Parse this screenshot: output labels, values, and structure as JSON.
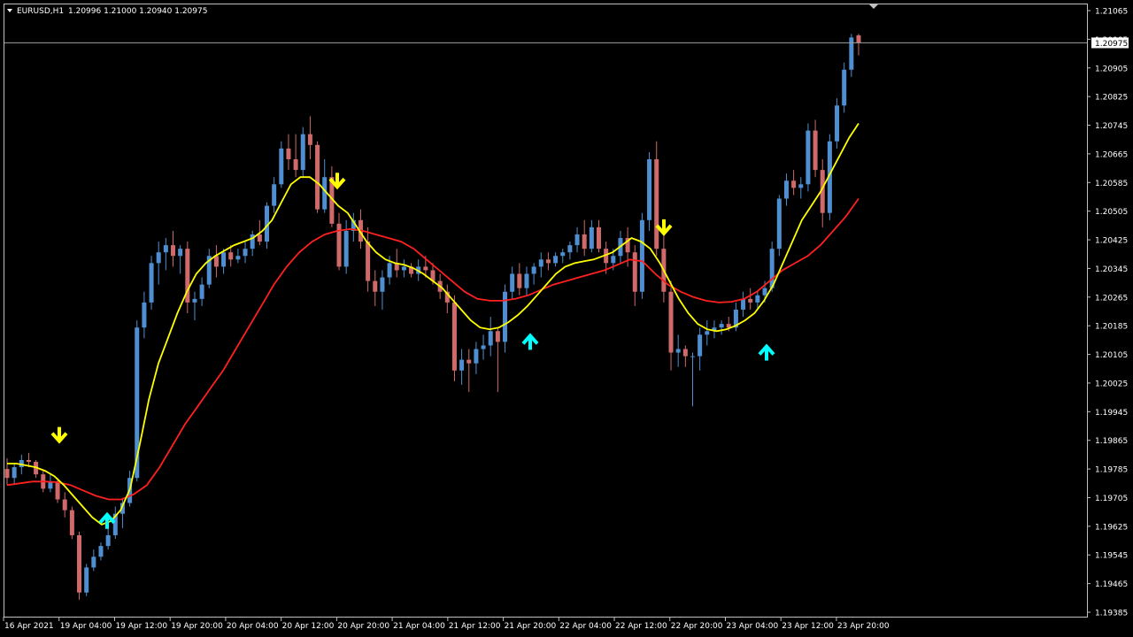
{
  "info": {
    "symbol": "EURUSD,H1",
    "ohlc": "1.20996 1.21000 1.20940 1.20975"
  },
  "colors": {
    "background": "#000000",
    "frame": "#c0c0c0",
    "bull": "#4f8fd1",
    "bear": "#d06a6a",
    "ma_fast": "#ffff00",
    "ma_slow": "#ff2020",
    "arrow_up": "#00ffff",
    "arrow_down": "#ffff00",
    "text": "#ffffff"
  },
  "chart_data": {
    "type": "candlestick",
    "title": "EURUSD,H1",
    "ylim": [
      1.19385,
      1.21065
    ],
    "y_ticks": [
      "1.21065",
      "1.20985",
      "1.20905",
      "1.20825",
      "1.20745",
      "1.20665",
      "1.20585",
      "1.20505",
      "1.20425",
      "1.20345",
      "1.20265",
      "1.20185",
      "1.20105",
      "1.20025",
      "1.19945",
      "1.19865",
      "1.19785",
      "1.19705",
      "1.19625",
      "1.19545",
      "1.19465",
      "1.19385"
    ],
    "x_ticks": [
      "16 Apr 2021",
      "19 Apr 04:00",
      "19 Apr 12:00",
      "19 Apr 20:00",
      "20 Apr 04:00",
      "20 Apr 12:00",
      "20 Apr 20:00",
      "21 Apr 04:00",
      "21 Apr 12:00",
      "21 Apr 20:00",
      "22 Apr 04:00",
      "22 Apr 12:00",
      "22 Apr 20:00",
      "23 Apr 04:00",
      "23 Apr 12:00",
      "23 Apr 20:00"
    ],
    "current_price": "1.20975",
    "candles": [
      [
        1.19785,
        1.19815,
        1.1974,
        1.1976
      ],
      [
        1.1976,
        1.198,
        1.1974,
        1.1979
      ],
      [
        1.1979,
        1.19825,
        1.1977,
        1.1981
      ],
      [
        1.1981,
        1.1983,
        1.1979,
        1.19805
      ],
      [
        1.19805,
        1.1981,
        1.1976,
        1.1977
      ],
      [
        1.1977,
        1.1978,
        1.1972,
        1.1973
      ],
      [
        1.1973,
        1.1977,
        1.1972,
        1.1975
      ],
      [
        1.1975,
        1.1976,
        1.1969,
        1.197
      ],
      [
        1.197,
        1.1972,
        1.1965,
        1.1967
      ],
      [
        1.1967,
        1.1968,
        1.1959,
        1.196
      ],
      [
        1.196,
        1.1961,
        1.1942,
        1.1944
      ],
      [
        1.1944,
        1.1952,
        1.1943,
        1.1951
      ],
      [
        1.1951,
        1.1956,
        1.195,
        1.1954
      ],
      [
        1.1954,
        1.1958,
        1.1953,
        1.1957
      ],
      [
        1.1957,
        1.1962,
        1.1956,
        1.196
      ],
      [
        1.196,
        1.1968,
        1.1959,
        1.1966
      ],
      [
        1.1966,
        1.197,
        1.1962,
        1.1969
      ],
      [
        1.1969,
        1.1978,
        1.1968,
        1.1976
      ],
      [
        1.1976,
        1.202,
        1.1975,
        1.2018
      ],
      [
        1.2018,
        1.2028,
        1.2015,
        1.2025
      ],
      [
        1.2025,
        1.2038,
        1.2023,
        1.2036
      ],
      [
        1.2036,
        1.2042,
        1.203,
        1.2039
      ],
      [
        1.2039,
        1.2043,
        1.2034,
        1.2041
      ],
      [
        1.2041,
        1.2045,
        1.2035,
        1.2038
      ],
      [
        1.2038,
        1.2041,
        1.2033,
        1.204
      ],
      [
        1.204,
        1.2042,
        1.2022,
        1.2025
      ],
      [
        1.2025,
        1.2028,
        1.202,
        1.2026
      ],
      [
        1.2026,
        1.2032,
        1.2024,
        1.203
      ],
      [
        1.203,
        1.204,
        1.2029,
        1.2038
      ],
      [
        1.2038,
        1.2041,
        1.2032,
        1.2035
      ],
      [
        1.2035,
        1.204,
        1.2033,
        1.2039
      ],
      [
        1.2039,
        1.2041,
        1.2035,
        1.2037
      ],
      [
        1.2037,
        1.204,
        1.2036,
        1.2038
      ],
      [
        1.2038,
        1.2042,
        1.2036,
        1.204
      ],
      [
        1.204,
        1.2045,
        1.2038,
        1.2044
      ],
      [
        1.2044,
        1.2048,
        1.2041,
        1.2042
      ],
      [
        1.2042,
        1.2053,
        1.204,
        1.2052
      ],
      [
        1.2052,
        1.206,
        1.205,
        1.2058
      ],
      [
        1.2058,
        1.207,
        1.2057,
        1.2068
      ],
      [
        1.2068,
        1.2072,
        1.2062,
        1.2065
      ],
      [
        1.2065,
        1.2072,
        1.206,
        1.2062
      ],
      [
        1.2062,
        1.2074,
        1.206,
        1.2072
      ],
      [
        1.2072,
        1.2077,
        1.2065,
        1.2069
      ],
      [
        1.2069,
        1.207,
        1.205,
        1.2051
      ],
      [
        1.2051,
        1.2065,
        1.205,
        1.206
      ],
      [
        1.206,
        1.2063,
        1.2046,
        1.2047
      ],
      [
        1.2047,
        1.205,
        1.2034,
        1.2035
      ],
      [
        1.2035,
        1.2048,
        1.2033,
        1.2045
      ],
      [
        1.2045,
        1.205,
        1.2042,
        1.2048
      ],
      [
        1.2048,
        1.2051,
        1.204,
        1.2042
      ],
      [
        1.2042,
        1.2046,
        1.2028,
        1.2031
      ],
      [
        1.2031,
        1.2034,
        1.2024,
        1.2028
      ],
      [
        1.2028,
        1.2034,
        1.2023,
        1.2032
      ],
      [
        1.2032,
        1.2038,
        1.203,
        1.2036
      ],
      [
        1.2036,
        1.204,
        1.2032,
        1.2034
      ],
      [
        1.2034,
        1.2037,
        1.2032,
        1.2035
      ],
      [
        1.2035,
        1.2036,
        1.2032,
        1.2033
      ],
      [
        1.2033,
        1.2037,
        1.2031,
        1.2035
      ],
      [
        1.2035,
        1.2038,
        1.2032,
        1.2034
      ],
      [
        1.2034,
        1.2036,
        1.203,
        1.2031
      ],
      [
        1.2031,
        1.2033,
        1.2026,
        1.2028
      ],
      [
        1.2028,
        1.203,
        1.2022,
        1.2025
      ],
      [
        1.2025,
        1.2027,
        1.2003,
        1.2006
      ],
      [
        1.2006,
        1.2012,
        1.2002,
        1.2009
      ],
      [
        1.2009,
        1.2012,
        1.2,
        1.2008
      ],
      [
        1.2008,
        1.2014,
        1.2005,
        1.2012
      ],
      [
        1.2012,
        1.2016,
        1.2009,
        1.2013
      ],
      [
        1.2013,
        1.2021,
        1.201,
        1.2017
      ],
      [
        1.2017,
        1.2018,
        1.2,
        1.2014
      ],
      [
        1.2014,
        1.203,
        1.2011,
        1.2028
      ],
      [
        1.2028,
        1.2035,
        1.2026,
        1.2033
      ],
      [
        1.2033,
        1.2036,
        1.2027,
        1.2029
      ],
      [
        1.2029,
        1.2035,
        1.2027,
        1.2033
      ],
      [
        1.2033,
        1.2036,
        1.203,
        1.2035
      ],
      [
        1.2035,
        1.2039,
        1.2032,
        1.2037
      ],
      [
        1.2037,
        1.2039,
        1.2034,
        1.2036
      ],
      [
        1.2036,
        1.2039,
        1.2035,
        1.2038
      ],
      [
        1.2038,
        1.204,
        1.2036,
        1.2039
      ],
      [
        1.2039,
        1.2042,
        1.2037,
        1.2041
      ],
      [
        1.2041,
        1.2046,
        1.2039,
        1.2044
      ],
      [
        1.2044,
        1.2048,
        1.2038,
        1.204
      ],
      [
        1.204,
        1.2048,
        1.2039,
        1.2046
      ],
      [
        1.2046,
        1.2048,
        1.2039,
        1.204
      ],
      [
        1.204,
        1.2042,
        1.2033,
        1.2036
      ],
      [
        1.2036,
        1.204,
        1.2034,
        1.2038
      ],
      [
        1.2038,
        1.2045,
        1.2036,
        1.2043
      ],
      [
        1.2043,
        1.2046,
        1.2035,
        1.2039
      ],
      [
        1.2039,
        1.2041,
        1.2024,
        1.2028
      ],
      [
        1.2028,
        1.205,
        1.2026,
        1.2048
      ],
      [
        1.2048,
        1.2067,
        1.2045,
        1.2065
      ],
      [
        1.2065,
        1.207,
        1.2038,
        1.204
      ],
      [
        1.204,
        1.2045,
        1.2025,
        1.2028
      ],
      [
        1.2028,
        1.2031,
        1.2006,
        1.2011
      ],
      [
        1.2011,
        1.2016,
        1.2007,
        1.2012
      ],
      [
        1.2012,
        1.2013,
        1.2007,
        1.201
      ],
      [
        1.201,
        1.2011,
        1.1996,
        1.201
      ],
      [
        1.201,
        1.2018,
        1.2006,
        1.2016
      ],
      [
        1.2016,
        1.202,
        1.2013,
        1.2017
      ],
      [
        1.2017,
        1.202,
        1.2015,
        1.2018
      ],
      [
        1.2018,
        1.202,
        1.2016,
        1.2019
      ],
      [
        1.2019,
        1.2021,
        1.2017,
        1.2018
      ],
      [
        1.2018,
        1.2025,
        1.2017,
        1.2023
      ],
      [
        1.2023,
        1.2028,
        1.2021,
        1.2026
      ],
      [
        1.2026,
        1.2029,
        1.2023,
        1.2025
      ],
      [
        1.2025,
        1.2028,
        1.2023,
        1.2027
      ],
      [
        1.2027,
        1.2031,
        1.2025,
        1.2029
      ],
      [
        1.2029,
        1.2042,
        1.2028,
        1.204
      ],
      [
        1.204,
        1.2055,
        1.2038,
        1.2054
      ],
      [
        1.2054,
        1.2061,
        1.2052,
        1.2059
      ],
      [
        1.2059,
        1.2062,
        1.2055,
        1.2057
      ],
      [
        1.2057,
        1.206,
        1.2054,
        1.2058
      ],
      [
        1.2058,
        1.2075,
        1.2056,
        1.2073
      ],
      [
        1.2073,
        1.2076,
        1.206,
        1.2062
      ],
      [
        1.2062,
        1.2065,
        1.2046,
        1.205
      ],
      [
        1.205,
        1.2072,
        1.2048,
        1.207
      ],
      [
        1.207,
        1.2082,
        1.2068,
        1.208
      ],
      [
        1.208,
        1.2092,
        1.2078,
        1.209
      ],
      [
        1.209,
        1.21,
        1.2088,
        1.2099
      ],
      [
        1.20996,
        1.21,
        1.2094,
        1.20975
      ]
    ],
    "ma_fast": [
      1.198,
      1.198,
      1.19795,
      1.1979,
      1.1978,
      1.19765,
      1.1974,
      1.1971,
      1.1968,
      1.1965,
      1.1963,
      1.1964,
      1.1967,
      1.1973,
      1.1985,
      1.1998,
      1.2008,
      1.2015,
      1.2022,
      1.2028,
      1.2033,
      1.2036,
      1.2038,
      1.20395,
      1.2041,
      1.2042,
      1.2043,
      1.2045,
      1.2048,
      1.2053,
      1.2058,
      1.206,
      1.206,
      1.2058,
      1.2055,
      1.2052,
      1.205,
      1.2046,
      1.2042,
      1.2039,
      1.2037,
      1.2036,
      1.20355,
      1.20345,
      1.2033,
      1.2031,
      1.2029,
      1.2026,
      1.2023,
      1.202,
      1.2018,
      1.20175,
      1.2018,
      1.20195,
      1.20215,
      1.2024,
      1.2027,
      1.203,
      1.2033,
      1.2035,
      1.2036,
      1.20365,
      1.2037,
      1.2038,
      1.2039,
      1.2041,
      1.2043,
      1.2042,
      1.204,
      1.2036,
      1.2031,
      1.2026,
      1.2022,
      1.2019,
      1.20175,
      1.2017,
      1.20175,
      1.20185,
      1.202,
      1.2022,
      1.20255,
      1.203,
      1.2036,
      1.2042,
      1.2048,
      1.2052,
      1.2056,
      1.2061,
      1.2066,
      1.2071,
      1.2075
    ],
    "ma_slow": [
      1.1974,
      1.19745,
      1.1975,
      1.1975,
      1.19748,
      1.1974,
      1.19725,
      1.1971,
      1.197,
      1.197,
      1.19715,
      1.1974,
      1.1979,
      1.1985,
      1.1991,
      1.1996,
      1.2001,
      1.2006,
      1.2012,
      1.2018,
      1.2024,
      1.203,
      1.2035,
      1.2039,
      1.2042,
      1.2044,
      1.2045,
      1.20455,
      1.2045,
      1.2044,
      1.2043,
      1.2042,
      1.204,
      1.2037,
      1.2034,
      1.2031,
      1.2028,
      1.2026,
      1.20255,
      1.20255,
      1.2026,
      1.2027,
      1.20285,
      1.203,
      1.2031,
      1.2032,
      1.2033,
      1.2034,
      1.20355,
      1.2037,
      1.20365,
      1.2033,
      1.203,
      1.2028,
      1.20265,
      1.20255,
      1.2025,
      1.20252,
      1.2026,
      1.2028,
      1.2031,
      1.2034,
      1.2036,
      1.2038,
      1.2041,
      1.2045,
      1.2049,
      1.2054
    ]
  }
}
